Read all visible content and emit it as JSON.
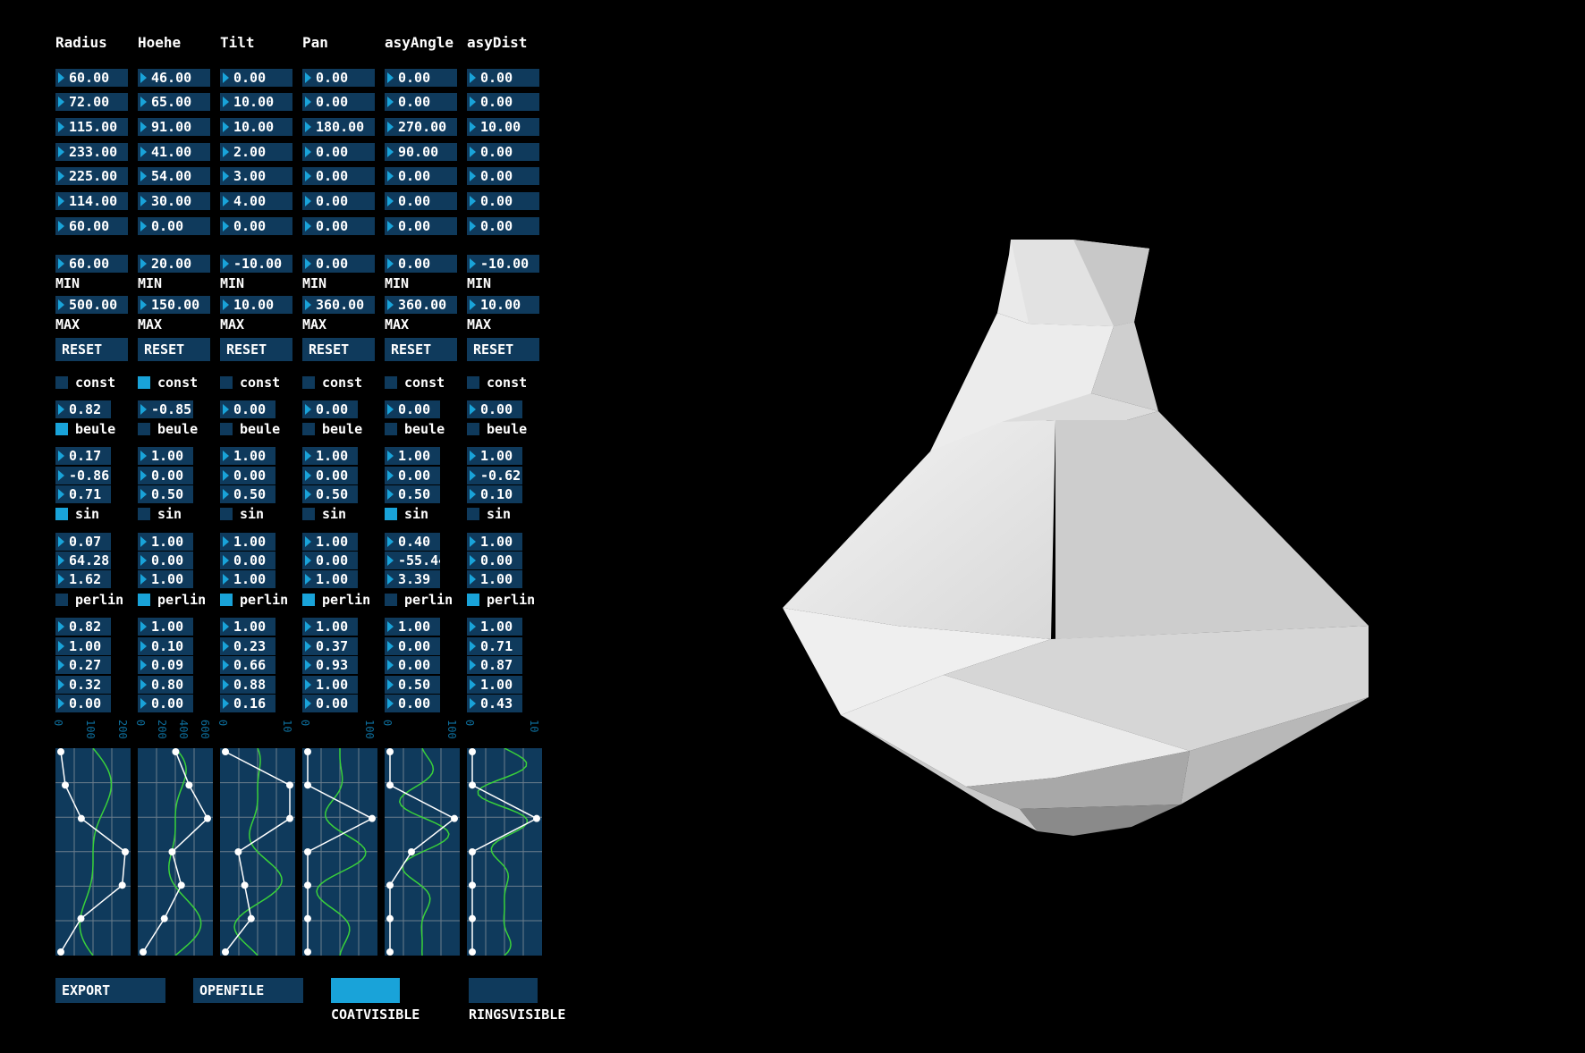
{
  "columns": [
    {
      "header": "Radius",
      "values": [
        "60.00",
        "72.00",
        "115.00",
        "233.00",
        "225.00",
        "114.00",
        "60.00"
      ],
      "min": "60.00",
      "max": "500.00",
      "const": {
        "on": false,
        "value": "0.82"
      },
      "beule": {
        "on": true,
        "values": [
          "0.17",
          "-0.86",
          "0.71"
        ]
      },
      "sin": {
        "on": true,
        "values": [
          "0.07",
          "64.28",
          "1.62"
        ]
      },
      "perlin": {
        "on": false,
        "values": [
          "0.82",
          "1.00",
          "0.27",
          "0.32",
          "0.00"
        ]
      },
      "axis": [
        "0",
        "100",
        "200"
      ]
    },
    {
      "header": "Hoehe",
      "values": [
        "46.00",
        "65.00",
        "91.00",
        "41.00",
        "54.00",
        "30.00",
        "0.00"
      ],
      "min": "20.00",
      "max": "150.00",
      "const": {
        "on": true,
        "value": "-0.85"
      },
      "beule": {
        "on": false,
        "values": [
          "1.00",
          "0.00",
          "0.50"
        ]
      },
      "sin": {
        "on": false,
        "values": [
          "1.00",
          "0.00",
          "1.00"
        ]
      },
      "perlin": {
        "on": true,
        "values": [
          "1.00",
          "0.10",
          "0.09",
          "0.80",
          "0.00"
        ]
      },
      "axis": [
        "0",
        "200",
        "400",
        "600"
      ]
    },
    {
      "header": "Tilt",
      "values": [
        "0.00",
        "10.00",
        "10.00",
        "2.00",
        "3.00",
        "4.00",
        "0.00"
      ],
      "min": "-10.00",
      "max": "10.00",
      "const": {
        "on": false,
        "value": "0.00"
      },
      "beule": {
        "on": false,
        "values": [
          "1.00",
          "0.00",
          "0.50"
        ]
      },
      "sin": {
        "on": false,
        "values": [
          "1.00",
          "0.00",
          "1.00"
        ]
      },
      "perlin": {
        "on": true,
        "values": [
          "1.00",
          "0.23",
          "0.66",
          "0.88",
          "0.16"
        ]
      },
      "axis": [
        "0",
        "10"
      ]
    },
    {
      "header": "Pan",
      "values": [
        "0.00",
        "0.00",
        "180.00",
        "0.00",
        "0.00",
        "0.00",
        "0.00"
      ],
      "min": "0.00",
      "max": "360.00",
      "const": {
        "on": false,
        "value": "0.00"
      },
      "beule": {
        "on": false,
        "values": [
          "1.00",
          "0.00",
          "0.50"
        ]
      },
      "sin": {
        "on": false,
        "values": [
          "1.00",
          "0.00",
          "1.00"
        ]
      },
      "perlin": {
        "on": true,
        "values": [
          "1.00",
          "0.37",
          "0.93",
          "1.00",
          "0.00"
        ]
      },
      "axis": [
        "0",
        "100"
      ]
    },
    {
      "header": "asyAngle",
      "values": [
        "0.00",
        "0.00",
        "270.00",
        "90.00",
        "0.00",
        "0.00",
        "0.00"
      ],
      "min": "0.00",
      "max": "360.00",
      "const": {
        "on": false,
        "value": "0.00"
      },
      "beule": {
        "on": false,
        "values": [
          "1.00",
          "0.00",
          "0.50"
        ]
      },
      "sin": {
        "on": true,
        "values": [
          "0.40",
          "-55.44",
          "3.39"
        ]
      },
      "perlin": {
        "on": false,
        "values": [
          "1.00",
          "0.00",
          "0.00",
          "0.50",
          "0.00"
        ]
      },
      "axis": [
        "0",
        "100"
      ]
    },
    {
      "header": "asyDist",
      "values": [
        "0.00",
        "0.00",
        "10.00",
        "0.00",
        "0.00",
        "0.00",
        "0.00"
      ],
      "min": "-10.00",
      "max": "10.00",
      "const": {
        "on": false,
        "value": "0.00"
      },
      "beule": {
        "on": false,
        "values": [
          "1.00",
          "-0.62",
          "0.10"
        ]
      },
      "sin": {
        "on": false,
        "values": [
          "1.00",
          "0.00",
          "1.00"
        ]
      },
      "perlin": {
        "on": true,
        "values": [
          "1.00",
          "0.71",
          "0.87",
          "1.00",
          "0.43"
        ]
      },
      "axis": [
        "0",
        "10"
      ]
    }
  ],
  "labels": {
    "min": "MIN",
    "max": "MAX",
    "reset": "RESET",
    "const": "const",
    "beule": "beule",
    "sin": "sin",
    "perlin": "perlin"
  },
  "bottom": {
    "export": "EXPORT",
    "openfile": "OPENFILE",
    "coatvisible": "COATVISIBLE",
    "ringsvisible": "RINGSVISIBLE",
    "coat_on": true,
    "rings_on": false
  },
  "colors": {
    "panel": "#0f3a5c",
    "accent": "#19a3d9",
    "curve": "#39d13a",
    "background": "#000000"
  }
}
